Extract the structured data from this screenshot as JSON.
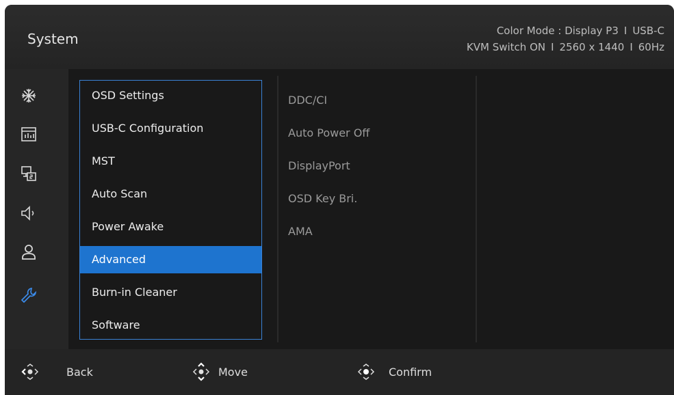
{
  "header": {
    "title": "System",
    "status_line1": {
      "color_mode": "Color Mode : Display P3",
      "input": "USB-C"
    },
    "status_line2": {
      "kvm": "KVM Switch ON",
      "resolution": "2560 x 1440",
      "refresh": "60Hz"
    },
    "separator": "I"
  },
  "sidebar_icons": [
    "sparkle-icon",
    "chart-icon",
    "display-input-icon",
    "speaker-icon",
    "user-icon",
    "wrench-icon"
  ],
  "submenu": {
    "items": [
      {
        "label": "OSD Settings"
      },
      {
        "label": "USB-C Configuration"
      },
      {
        "label": "MST"
      },
      {
        "label": "Auto Scan"
      },
      {
        "label": "Power Awake"
      },
      {
        "label": "Advanced"
      },
      {
        "label": "Burn-in Cleaner"
      },
      {
        "label": "Software"
      }
    ],
    "selected": "Advanced"
  },
  "options": {
    "items": [
      {
        "label": "DDC/CI"
      },
      {
        "label": "Auto Power Off"
      },
      {
        "label": "DisplayPort"
      },
      {
        "label": "OSD Key Bri."
      },
      {
        "label": "AMA"
      }
    ]
  },
  "footer": {
    "back_label": "Back",
    "move_label": "Move",
    "confirm_label": "Confirm"
  },
  "colors": {
    "accent": "#1e74cf",
    "selected_icon": "#3b8bea"
  }
}
